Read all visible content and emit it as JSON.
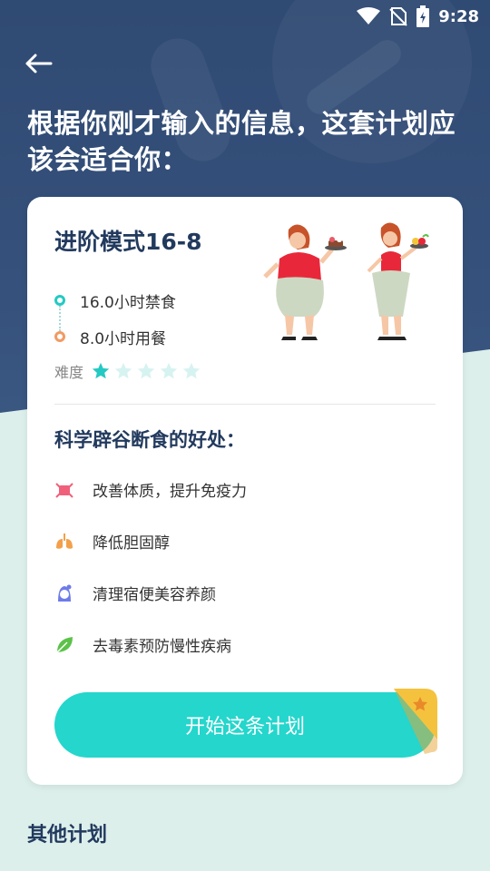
{
  "status_bar": {
    "time": "9:28",
    "icons": [
      "wifi-icon",
      "no-sim-icon",
      "battery-charging-icon"
    ]
  },
  "nav": {
    "back_icon": "arrow-left-icon"
  },
  "headline": "根据你刚才输入的信息，这套计划应该会适合你：",
  "plan": {
    "title": "进阶模式16-8",
    "fasting": "16.0小时禁食",
    "eating": "8.0小时用餐",
    "difficulty_label": "难度",
    "difficulty_level": 1,
    "difficulty_max": 5
  },
  "benefits": {
    "title": "科学辟谷断食的好处：",
    "items": [
      {
        "icon": "body-icon",
        "label": "改善体质，提升免疫力",
        "color": "#f0607a"
      },
      {
        "icon": "lungs-icon",
        "label": "降低胆固醇",
        "color": "#f3a04a"
      },
      {
        "icon": "face-icon",
        "label": "清理宿便美容养颜",
        "color": "#6d7ce8"
      },
      {
        "icon": "leaf-icon",
        "label": "去毒素预防慢性疾病",
        "color": "#5cc24a"
      }
    ]
  },
  "start_button": "开始这条计划",
  "other_plans_title": "其他计划",
  "colors": {
    "accent": "#24d6cc",
    "header_bg": "#2f4a73",
    "page_bg": "#dcefeb",
    "title_text": "#223a5e"
  }
}
